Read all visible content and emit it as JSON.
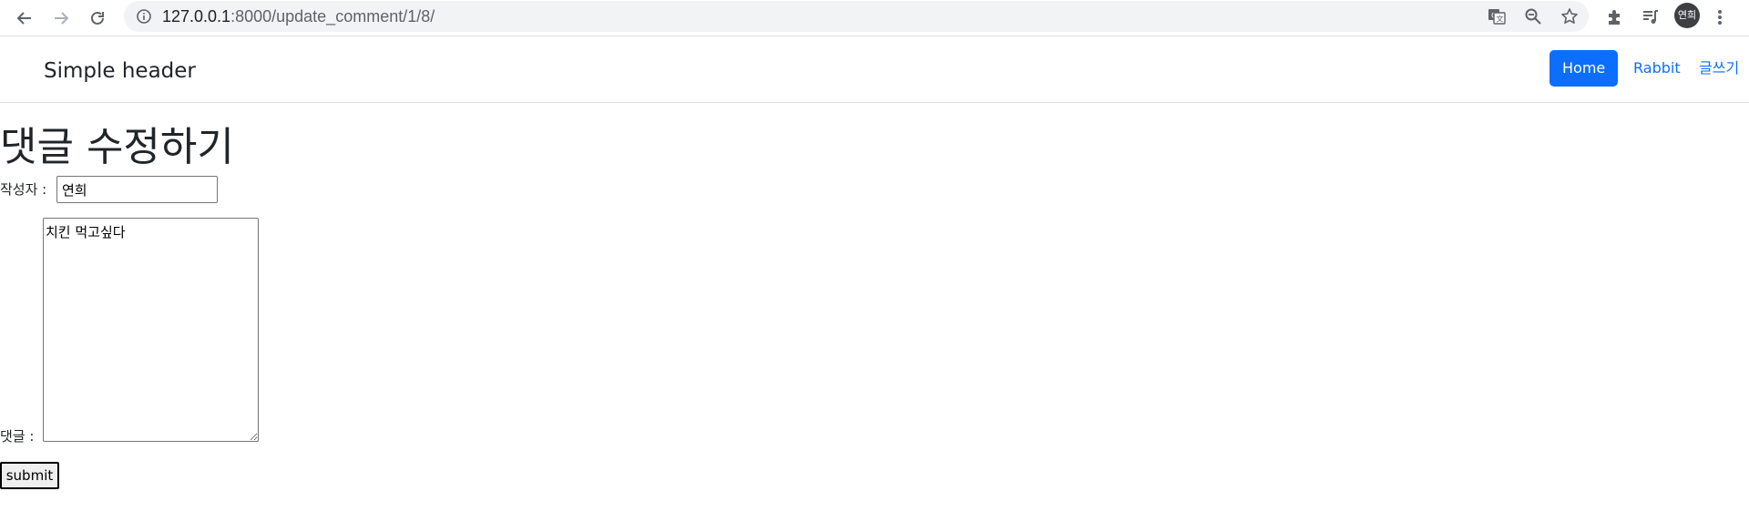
{
  "browser": {
    "url_host": "127.0.0.1",
    "url_path": ":8000/update_comment/1/8/",
    "profile_label": "연희",
    "icons": [
      "back-icon",
      "forward-icon",
      "reload-icon",
      "info-icon",
      "translate-icon",
      "zoom-icon",
      "star-icon",
      "extensions-icon",
      "media-icon",
      "menu-icon"
    ]
  },
  "header": {
    "brand": "Simple header",
    "nav": [
      {
        "label": "Home",
        "active": true
      },
      {
        "label": "Rabbit",
        "active": false
      },
      {
        "label": "글쓰기",
        "active": false
      }
    ]
  },
  "form": {
    "title": "댓글 수정하기",
    "author_label": "작성자 :",
    "author_value": "연희",
    "comment_label": "댓글 :",
    "comment_value": "치킨 먹고싶다",
    "submit_label": "submit"
  },
  "colors": {
    "primary": "#0d6efd",
    "text": "#212529"
  }
}
